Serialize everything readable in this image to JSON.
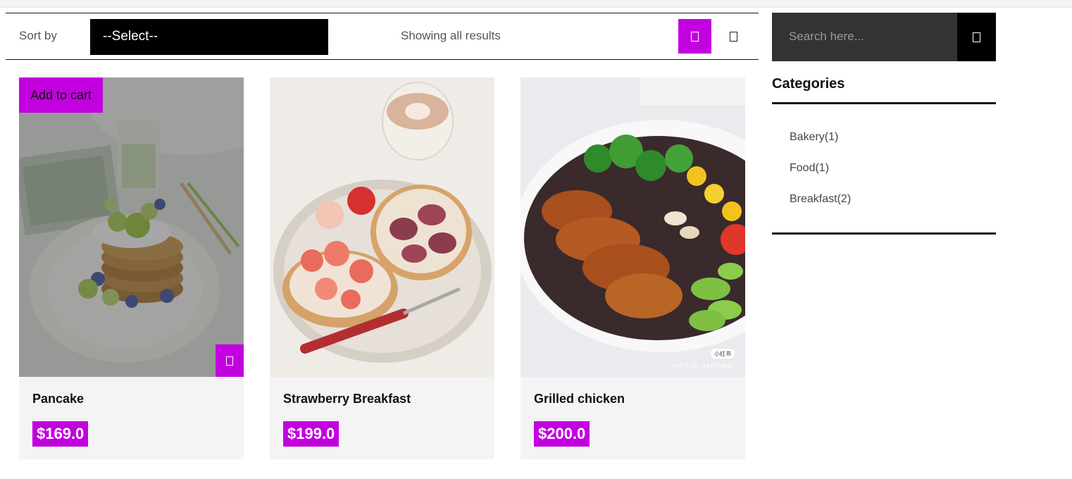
{
  "toolbar": {
    "sort_label": "Sort by",
    "sort_value": "--Select--",
    "results_text": "Showing all results"
  },
  "products": [
    {
      "name": "Pancake",
      "price": "$169.0"
    },
    {
      "name": "Strawberry Breakfast",
      "price": "$199.0"
    },
    {
      "name": "Grilled chicken",
      "price": "$200.0"
    }
  ],
  "hover": {
    "add_to_cart": "Add to cart"
  },
  "image_watermark": {
    "app": "小红书",
    "id": "小红书 ID：947674837"
  },
  "sidebar": {
    "search_placeholder": "Search here...",
    "categories_title": "Categories",
    "categories": [
      "Bakery(1)",
      "Food(1)",
      "Breakfast(2)"
    ]
  },
  "colors": {
    "accent": "#c300e0",
    "dark": "#000000",
    "search_bg": "#333333"
  }
}
